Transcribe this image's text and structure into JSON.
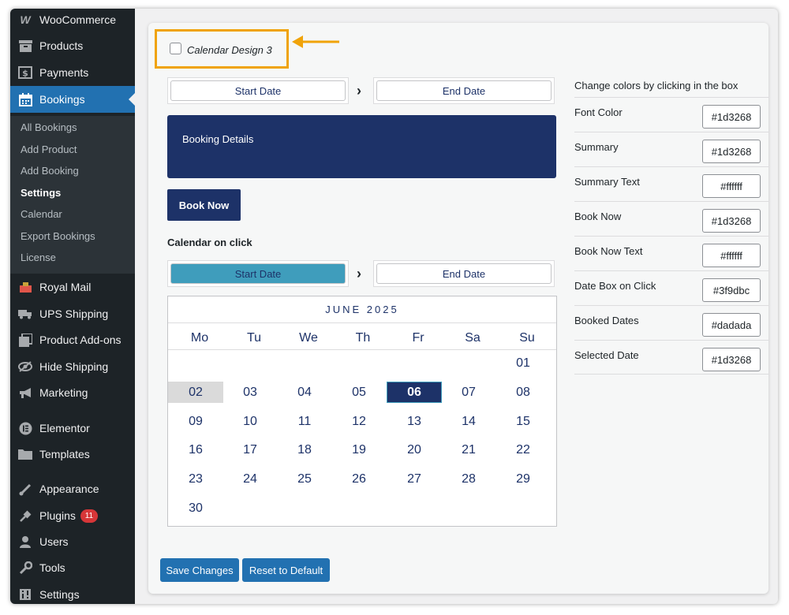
{
  "sidebar": {
    "items": [
      {
        "label": "WooCommerce",
        "icon": "woo-icon"
      },
      {
        "label": "Products",
        "icon": "archive-icon"
      },
      {
        "label": "Payments",
        "icon": "dollar-icon"
      },
      {
        "label": "Bookings",
        "icon": "calendar-icon"
      },
      {
        "label": "Royal Mail",
        "icon": "post-icon"
      },
      {
        "label": "UPS Shipping",
        "icon": "truck-icon"
      },
      {
        "label": "Product Add-ons",
        "icon": "addons-icon"
      },
      {
        "label": "Hide Shipping",
        "icon": "hidden-icon"
      },
      {
        "label": "Marketing",
        "icon": "megaphone-icon"
      },
      {
        "label": "Elementor",
        "icon": "elementor-icon"
      },
      {
        "label": "Templates",
        "icon": "folder-icon"
      },
      {
        "label": "Appearance",
        "icon": "brush-icon"
      },
      {
        "label": "Plugins",
        "icon": "plug-icon",
        "badge": "11"
      },
      {
        "label": "Users",
        "icon": "user-icon"
      },
      {
        "label": "Tools",
        "icon": "wrench-icon"
      },
      {
        "label": "Settings",
        "icon": "settings-icon"
      }
    ],
    "submenu": [
      {
        "label": "All Bookings"
      },
      {
        "label": "Add Product"
      },
      {
        "label": "Add Booking"
      },
      {
        "label": "Settings"
      },
      {
        "label": "Calendar"
      },
      {
        "label": "Export Bookings"
      },
      {
        "label": "License"
      }
    ]
  },
  "main": {
    "design_checkbox_label": "Calendar Design 3",
    "design_checkbox_checked": false,
    "start_date": "Start Date",
    "end_date": "End Date",
    "booking_details": "Booking Details",
    "book_now": "Book Now",
    "calendar_on_click": "Calendar on click",
    "calendar": {
      "month": "JUNE 2025",
      "weekdays": [
        "Mo",
        "Tu",
        "We",
        "Th",
        "Fr",
        "Sa",
        "Su"
      ],
      "days": [
        "01",
        "02",
        "03",
        "04",
        "05",
        "06",
        "07",
        "08",
        "09",
        "10",
        "11",
        "12",
        "13",
        "14",
        "15",
        "16",
        "17",
        "18",
        "19",
        "20",
        "21",
        "22",
        "23",
        "24",
        "25",
        "26",
        "27",
        "28",
        "29",
        "30"
      ],
      "booked_day": "02",
      "selected_day": "06"
    },
    "save_button": "Save Changes",
    "reset_button": "Reset to Default"
  },
  "colors": {
    "title": "Change colors by clicking in the box",
    "rows": [
      {
        "label": "Font Color",
        "value": "#1d3268"
      },
      {
        "label": "Summary",
        "value": "#1d3268"
      },
      {
        "label": "Summary Text",
        "value": "#ffffff"
      },
      {
        "label": "Book Now",
        "value": "#1d3268"
      },
      {
        "label": "Book Now Text",
        "value": "#ffffff"
      },
      {
        "label": "Date Box on Click",
        "value": "#3f9dbc"
      },
      {
        "label": "Booked Dates",
        "value": "#dadada"
      },
      {
        "label": "Selected Date",
        "value": "#1d3268"
      }
    ]
  },
  "theme": {
    "sidebar_bg": "#1d2327",
    "active_bg": "#2271b1",
    "highlight_border": "#f0a30a",
    "button_blue": "#2271b1"
  }
}
